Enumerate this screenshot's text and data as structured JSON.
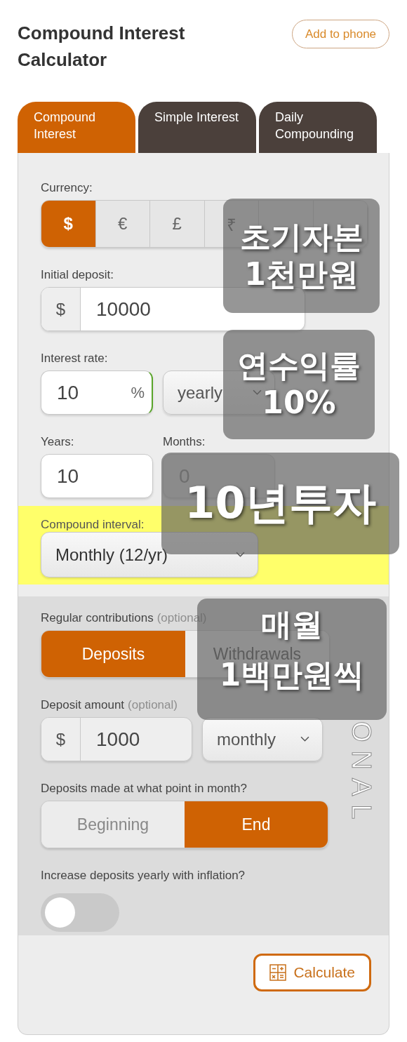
{
  "header": {
    "title": "Compound Interest Calculator",
    "add_button": "Add to phone"
  },
  "tabs": [
    {
      "label": "Compound Interest",
      "selected": true
    },
    {
      "label": "Simple Interest",
      "selected": false
    },
    {
      "label": "Daily Compounding",
      "selected": false
    }
  ],
  "currency": {
    "label": "Currency:",
    "options": [
      {
        "symbol": "$",
        "selected": true
      },
      {
        "symbol": "€",
        "selected": false
      },
      {
        "symbol": "£",
        "selected": false
      },
      {
        "symbol": "₹",
        "selected": false
      }
    ]
  },
  "initial_deposit": {
    "label": "Initial deposit:",
    "prefix": "$",
    "value": "10000"
  },
  "interest_rate": {
    "label": "Interest rate:",
    "value": "10",
    "suffix": "%",
    "period": "yearly"
  },
  "years": {
    "label": "Years:",
    "value": "10"
  },
  "months": {
    "label": "Months:",
    "value": "0",
    "disabled": true
  },
  "compound_interval": {
    "label": "Compound interval:",
    "value": "Monthly (12/yr)",
    "highlighted": true
  },
  "contributions": {
    "label": "Regular contributions",
    "note": "(optional)",
    "side_label": "ONAL",
    "types": [
      {
        "label": "Deposits",
        "selected": true
      },
      {
        "label": "Withdrawals",
        "selected": false
      }
    ],
    "amount_label": "Deposit amount",
    "amount_note": "(optional)",
    "prefix": "$",
    "amount": "1000",
    "frequency": "monthly",
    "timing_label": "Deposits made at what point in month?",
    "timing": [
      {
        "label": "Beginning",
        "selected": false
      },
      {
        "label": "End",
        "selected": true
      }
    ],
    "inflation_label": "Increase deposits yearly with inflation?",
    "inflation_on": false
  },
  "calculate_button": "Calculate",
  "annotations": [
    {
      "lines": [
        "초기자본",
        "1천만원"
      ]
    },
    {
      "lines": [
        "연수익률",
        "10%"
      ]
    },
    {
      "lines": [
        "10년투자"
      ]
    },
    {
      "lines": [
        "매월",
        "1백만원씩"
      ]
    }
  ]
}
